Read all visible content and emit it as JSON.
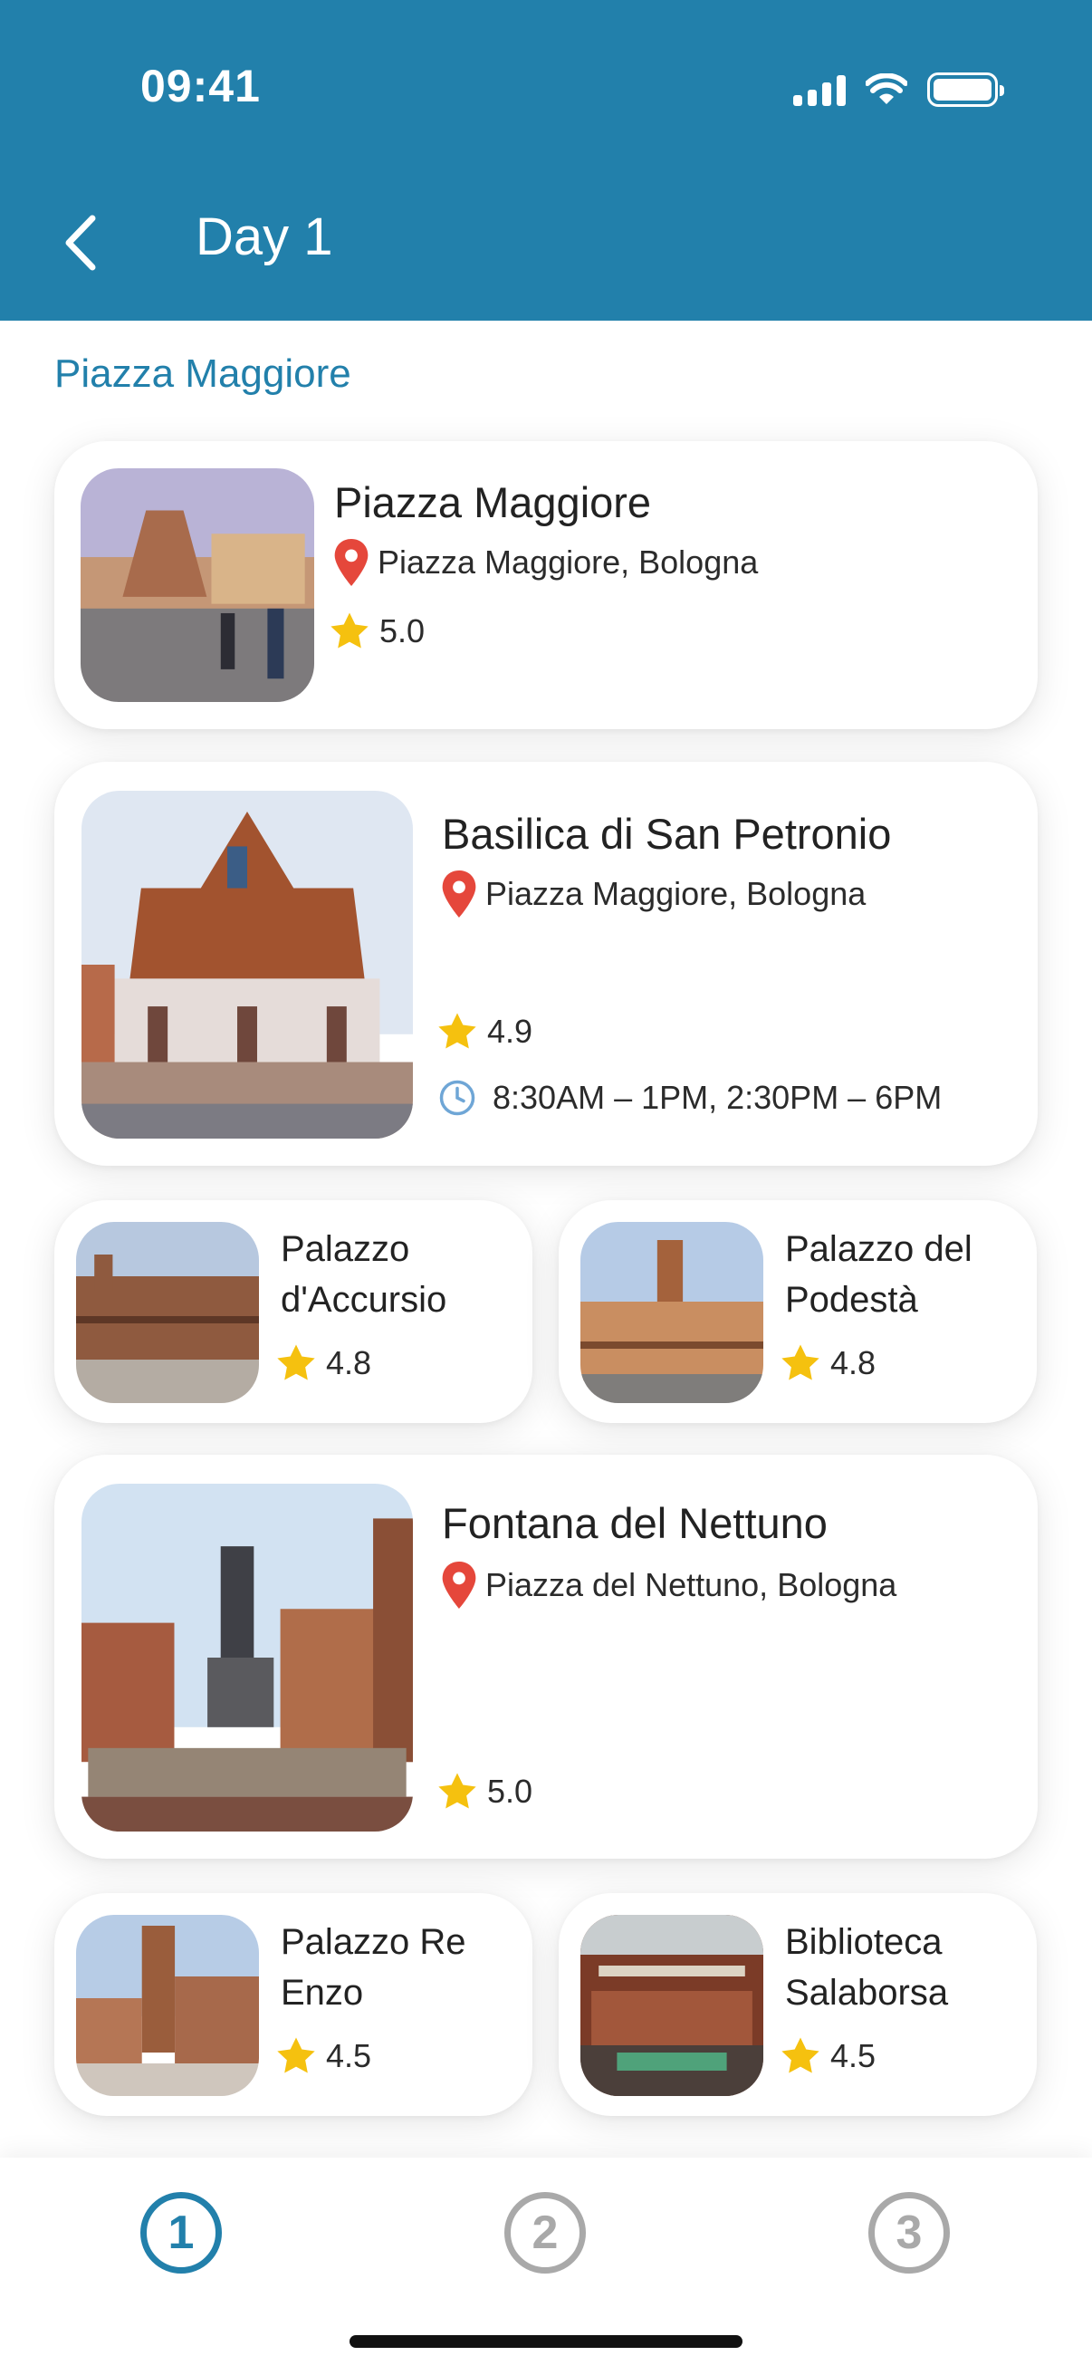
{
  "status": {
    "time": "09:41"
  },
  "header": {
    "title": "Day 1"
  },
  "section": {
    "title": "Piazza Maggiore"
  },
  "places": [
    {
      "title": "Piazza Maggiore",
      "address": "Piazza Maggiore, Bologna",
      "rating": "5.0"
    },
    {
      "title": "Basilica di San Petronio",
      "address": "Piazza Maggiore, Bologna",
      "rating": "4.9",
      "hours": "8:30AM – 1PM, 2:30PM – 6PM"
    },
    {
      "title_line1": "Palazzo",
      "title_line2": "d'Accursio",
      "rating": "4.8"
    },
    {
      "title_line1": "Palazzo del",
      "title_line2": "Podestà",
      "rating": "4.8"
    },
    {
      "title": "Fontana del Nettuno",
      "address": "Piazza del Nettuno, Bologna",
      "rating": "5.0"
    },
    {
      "title_line1": "Palazzo Re",
      "title_line2": "Enzo",
      "rating": "4.5"
    },
    {
      "title_line1": "Biblioteca",
      "title_line2": "Salaborsa",
      "rating": "4.5"
    }
  ],
  "nav": {
    "items": [
      "1",
      "2",
      "3"
    ],
    "active": "1"
  },
  "colors": {
    "primary": "#2280ab",
    "pin": "#e5473b",
    "star": "#f5c10f",
    "clock": "#6fa6d6"
  }
}
